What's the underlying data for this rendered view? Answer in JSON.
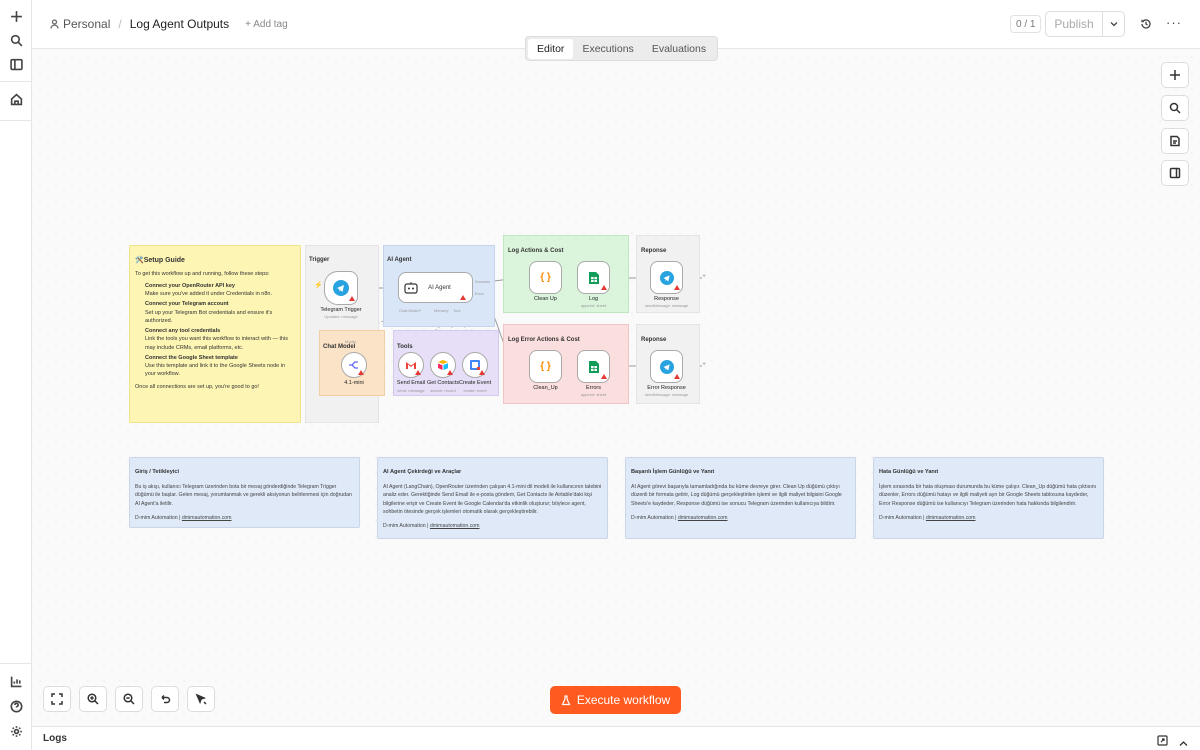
{
  "header": {
    "project": "Personal",
    "separator": "/",
    "workflow_name": "Log Agent Outputs",
    "add_tag": "+ Add tag",
    "version_count": "0 / 1",
    "publish_label": "Publish"
  },
  "tabs": [
    {
      "label": "Editor",
      "active": true
    },
    {
      "label": "Executions",
      "active": false
    },
    {
      "label": "Evaluations",
      "active": false
    }
  ],
  "setup_guide": {
    "title": "🛠️Setup Guide",
    "intro": "To get this workflow up and running, follow these steps:",
    "steps": [
      {
        "title": "Connect your OpenRouter API key",
        "text": "Make sure you've added it under Credentials in n8n."
      },
      {
        "title": "Connect your Telegram account",
        "text": "Set up your Telegram Bot credentials and ensure it's authorized."
      },
      {
        "title": "Connect any tool credentials",
        "text": "Link the tools you want this workflow to interact with — this may include CRMs, email platforms, etc."
      },
      {
        "title": "Connect the Google Sheet template",
        "text": "Use this template and link it to the Google Sheets node in your workflow."
      }
    ],
    "outro": "Once all connections are set up, you're good to go!"
  },
  "groups": {
    "trigger": "Trigger",
    "ai_agent": "AI Agent",
    "log_actions": "Log Actions & Cost",
    "response_top": "Reponse",
    "chat_model": "Chat Model",
    "tools": "Tools",
    "log_errors": "Log Error Actions & Cost",
    "response_bottom": "Reponse"
  },
  "nodes": {
    "telegram_trigger": {
      "label": "Telegram Trigger",
      "sub": "Updates: message"
    },
    "ai_agent": {
      "label": "AI Agent",
      "port_success": "Success",
      "port_error": "Error",
      "port_chat": "Chat Model*",
      "port_memory": "Memory",
      "port_tool": "Tool"
    },
    "chat_model": {
      "label": "4.1-mini",
      "port": "Model"
    },
    "send_email": {
      "label": "Send Email",
      "sub": "send: message"
    },
    "get_contacts": {
      "label": "Get Contacts",
      "sub": "search: record"
    },
    "create_event": {
      "label": "Create Event",
      "sub": "create: event"
    },
    "clean_up": {
      "label": "Clean Up"
    },
    "log": {
      "label": "Log",
      "sub": "append: sheet"
    },
    "response": {
      "label": "Response",
      "sub": "sendMessage: message"
    },
    "clean_up_err": {
      "label": "Clean_Up"
    },
    "errors": {
      "label": "Errors",
      "sub": "append: sheet"
    },
    "error_response": {
      "label": "Error Response",
      "sub": "sendMessage: message"
    }
  },
  "info_notes": [
    {
      "title": "Giriş / Tetikleyici",
      "text": "Bu iş akışı, kullanıcı Telegram üzerinden bota bir mesaj gönderdiğinde Telegram Trigger düğümü ile başlar. Gelen mesaj, yorumlanmak ve gerekli aksiyonun belirlenmesi için doğrudan AI Agent'a iletilir.",
      "footer": "D-mim Automation",
      "link": "dmimautomation.com"
    },
    {
      "title": "AI Agent Çekirdeği ve Araçlar",
      "text": "AI Agent (LangChain), OpenRouter üzerinden çalışan 4.1-mini dil modeli ile kullanıcının talebini analiz eder. Gerektiğinde Send Email ile e-posta gönderir, Get Contacts ile Airtable'daki kişi bilgilerine erişir ve Create Event ile Google Calendar'da etkinlik oluşturur; böylece agent, sohbetin ötesinde gerçek işlemleri otomatik olarak gerçekleştirebilir.",
      "footer": "D-mim Automation",
      "link": "dmimautomation.com"
    },
    {
      "title": "Başarılı İşlem Günlüğü ve Yanıt",
      "text": "AI Agent görevi başarıyla tamamladığında bu küme devreye girer. Clean Up düğümü çıktıyı düzenli bir formata getirir, Log düğümü gerçekleştirilen işlemi ve ilgili maliyet bilgisini Google Sheets'e kaydeder, Response düğümü ise sonucu Telegram üzerinden kullanıcıya bildirir.",
      "footer": "D-mim Automation",
      "link": "dmimautomation.com"
    },
    {
      "title": "Hata Günlüğü ve Yanıt",
      "text": "İşlem sırasında bir hata oluşması durumunda bu küme çalışır. Clean_Up düğümü hata çıktısını düzenler, Errors düğümü hatayı ve ilgili maliyeti ayrı bir Google Sheets tablosuna kaydeder, Error Response düğümü ise kullanıcıyı Telegram üzerinden hata hakkında bilgilendirir.",
      "footer": "D-mim Automation",
      "link": "dmimautomation.com"
    }
  ],
  "execute_label": "Execute workflow",
  "logs_label": "Logs",
  "colors": {
    "accent": "#ff6d5a",
    "execute": "#ff5a1f",
    "sticky_yellow": "#fdf5b4",
    "group_blue": "#d9e6f7",
    "group_green": "#dbf5dc",
    "group_red": "#fbdede",
    "group_orange": "#fbe3c7",
    "group_purple": "#e6dff7",
    "group_gray": "#f1f1f1"
  }
}
